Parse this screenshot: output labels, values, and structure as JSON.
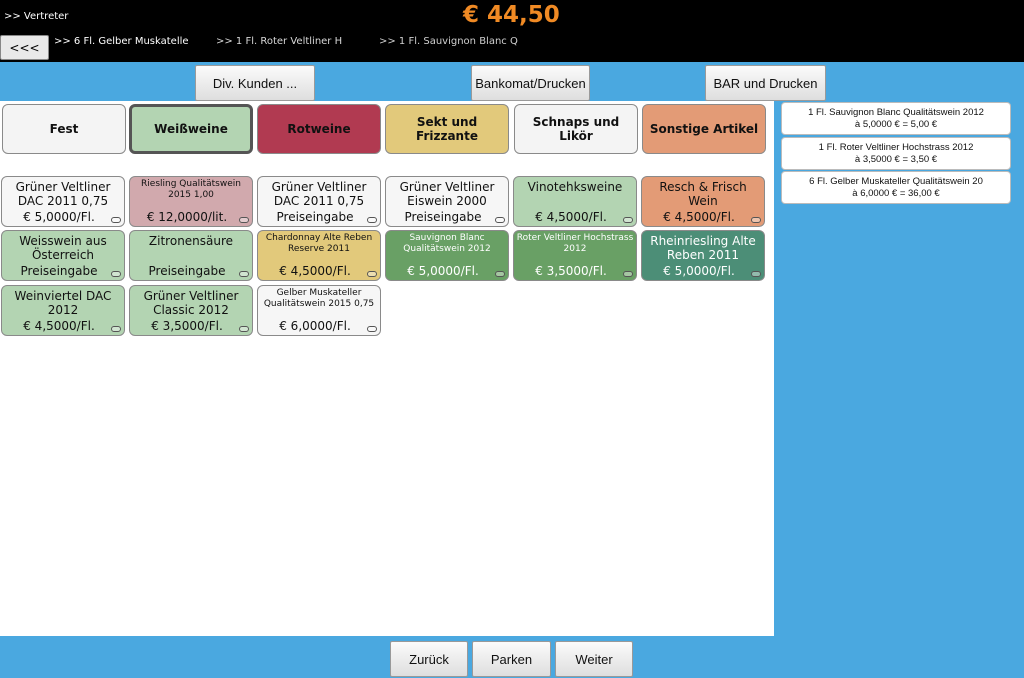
{
  "header": {
    "vertreter": ">> Vertreter",
    "total": "€ 44,50",
    "back_label": "<<<",
    "history": [
      ">> 6 Fl. Gelber Muskatelle",
      ">> 1 Fl. Roter Veltliner H",
      ">> 1 Fl. Sauvignon Blanc Q"
    ]
  },
  "actions": {
    "kunden": "Div. Kunden ...",
    "bankomat": "Bankomat/Drucken",
    "bar": "BAR und Drucken"
  },
  "categories": [
    {
      "label": "Fest",
      "color": "#f4f4f4"
    },
    {
      "label": "Weißweine",
      "color": "#b3d4b2",
      "active": true
    },
    {
      "label": "Rotweine",
      "color": "#b13a51"
    },
    {
      "label": "Sekt und Frizzante",
      "color": "#e2c97b"
    },
    {
      "label": "Schnaps und Likör",
      "color": "#f4f4f4"
    },
    {
      "label": "Sonstige Artikel",
      "color": "#e39b76"
    }
  ],
  "products": [
    {
      "name": "Grüner Veltliner DAC 2011 0,75",
      "price": "€ 5,0000/Fl.",
      "color": "#f6f6f6"
    },
    {
      "name": "Riesling Qualitätswein 2015 1,00",
      "price": "€ 12,0000/lit.",
      "color": "#d1a9ad",
      "small": true
    },
    {
      "name": "Grüner Veltliner DAC 2011 0,75",
      "price": "Preiseingabe",
      "color": "#f6f6f6"
    },
    {
      "name": "Grüner Veltliner Eiswein 2000",
      "price": "Preiseingabe",
      "color": "#f6f6f6"
    },
    {
      "name": "Vinotehksweine",
      "price": "€ 4,5000/Fl.",
      "color": "#b3d4b2"
    },
    {
      "name": "Resch & Frisch Wein",
      "price": "€ 4,5000/Fl.",
      "color": "#e39b76"
    },
    {
      "name": "Weisswein aus Österreich",
      "price": "Preiseingabe",
      "color": "#b3d4b2"
    },
    {
      "name": "Zitronensäure",
      "price": "Preiseingabe",
      "color": "#b3d4b2"
    },
    {
      "name": "Chardonnay Alte Reben Reserve 2011",
      "price": "€ 4,5000/Fl.",
      "color": "#e2c97b",
      "small": true
    },
    {
      "name": "Sauvignon Blanc Qualitätswein 2012",
      "price": "€ 5,0000/Fl.",
      "color": "#69a065",
      "small": true,
      "dark": true
    },
    {
      "name": "Roter Veltliner Hochstrass 2012",
      "price": "€ 3,5000/Fl.",
      "color": "#69a065",
      "small": true,
      "dark": true
    },
    {
      "name": "Rheinriesling Alte Reben 2011",
      "price": "€ 5,0000/Fl.",
      "color": "#4c8e77",
      "dark": true
    },
    {
      "name": "Weinviertel DAC 2012",
      "price": "€ 4,5000/Fl.",
      "color": "#b3d4b2"
    },
    {
      "name": "Grüner Veltliner Classic 2012",
      "price": "€ 3,5000/Fl.",
      "color": "#b3d4b2"
    },
    {
      "name": "Gelber Muskateller Qualitätswein 2015 0,75",
      "price": "€ 6,0000/Fl.",
      "color": "#f6f6f6",
      "small": true
    }
  ],
  "receipt": [
    {
      "line1": "1 Fl. Sauvignon Blanc Qualitätswein 2012",
      "line2": "à 5,0000 € = 5,00 €"
    },
    {
      "line1": "1 Fl. Roter Veltliner Hochstrass 2012",
      "line2": "à 3,5000 € = 3,50 €"
    },
    {
      "line1": "6 Fl. Gelber Muskateller Qualitätswein 20",
      "line2": "à 6,0000 € = 36,00 €"
    }
  ],
  "footer": {
    "zurueck": "Zurück",
    "parken": "Parken",
    "weiter": "Weiter"
  }
}
